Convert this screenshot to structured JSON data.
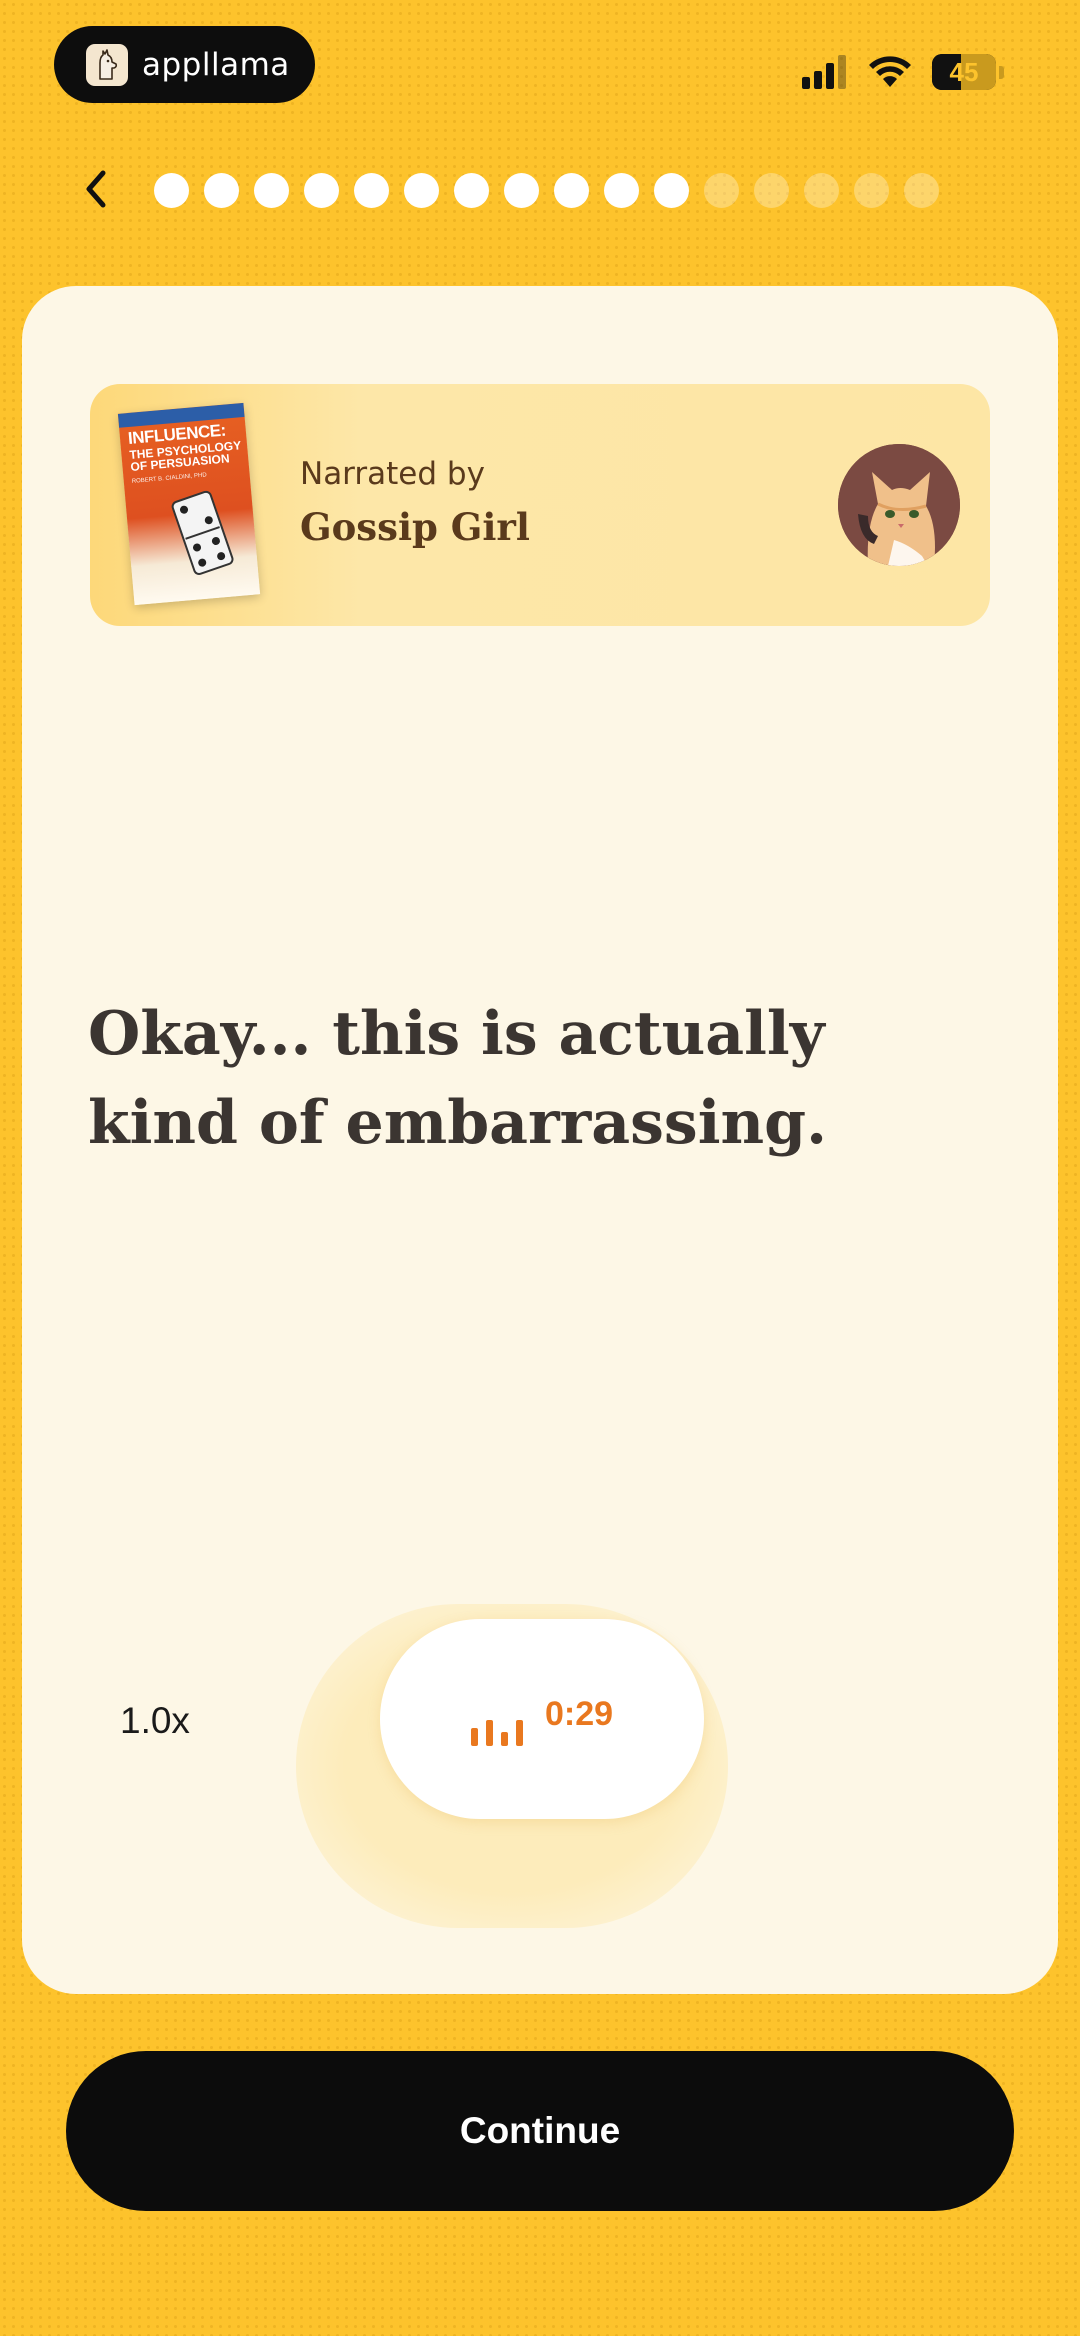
{
  "status_bar": {
    "app_name": "appllama",
    "battery": "45",
    "battery_level": 0.45
  },
  "progress": {
    "completed_steps": 11,
    "total_steps": 16
  },
  "narration": {
    "label": "Narrated by",
    "narrator": "Gossip Girl",
    "book_cover": {
      "title": "INFLUENCE:",
      "subtitle": "THE PSYCHOLOGY OF PERSUASION",
      "author": "ROBERT B. CIALDINI, PHD"
    }
  },
  "main": {
    "quote": "Okay... this is actually kind of embarrassing."
  },
  "player": {
    "speed": "1.0x",
    "time": "0:29"
  },
  "footer": {
    "continue_label": "Continue"
  },
  "colors": {
    "background": "#fdc32c",
    "card": "#fdf7e6",
    "accent": "#e9781f",
    "text": "#3b3531"
  },
  "icons": [
    "llama-logo-icon",
    "signal-icon",
    "wifi-icon",
    "battery-icon",
    "back-chevron-icon",
    "audio-bars-icon"
  ]
}
